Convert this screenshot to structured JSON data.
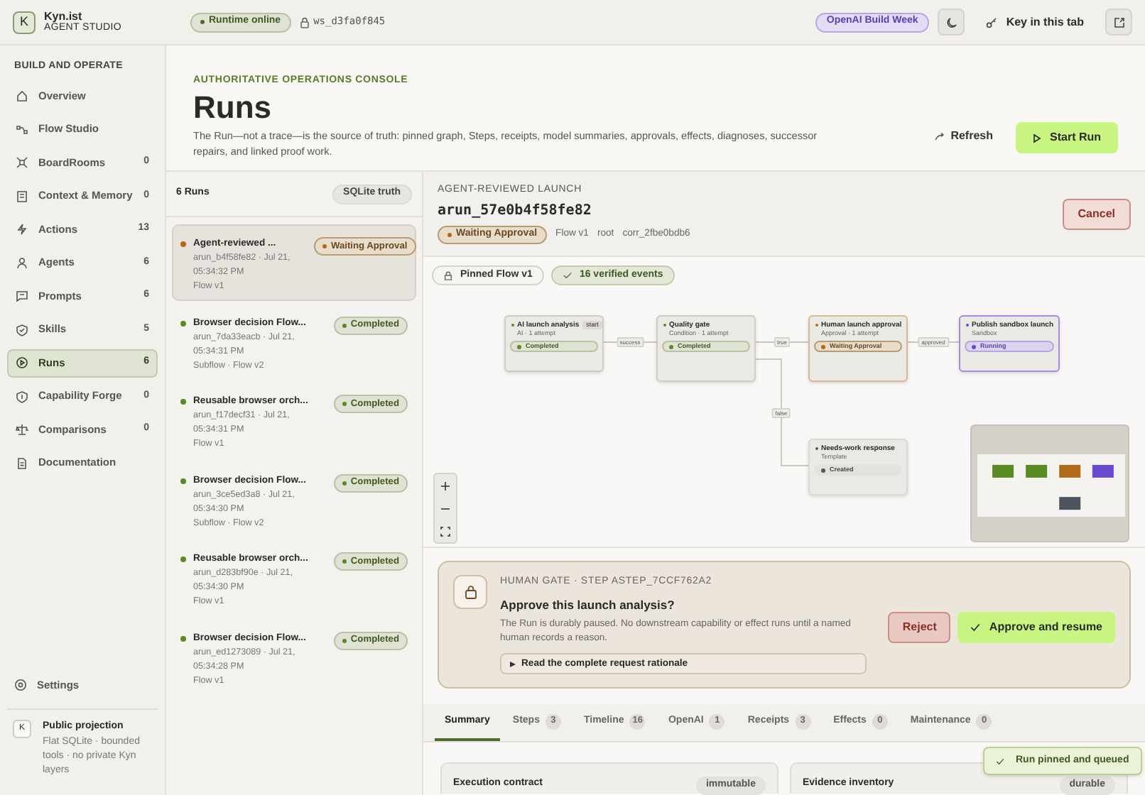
{
  "top_bar": {
    "brand": {
      "logo": "K",
      "name": "Kyn.ist",
      "subtitle": "AGENT STUDIO"
    },
    "runtime_status": "Runtime online",
    "workspace": "ws_d3fa0f845",
    "event_badge": "OpenAI Build Week",
    "key_button": "Key in this tab"
  },
  "sidebar": {
    "section": "BUILD AND OPERATE",
    "items": [
      {
        "label": "Overview",
        "selected": false
      },
      {
        "label": "Flow Studio",
        "selected": false
      },
      {
        "label": "BoardRooms",
        "count": "0",
        "selected": false
      },
      {
        "label": "Context & Memory",
        "count": "0",
        "selected": false
      },
      {
        "label": "Actions",
        "count": "13",
        "selected": false
      },
      {
        "label": "Agents",
        "count": "6",
        "selected": false
      },
      {
        "label": "Prompts",
        "count": "6",
        "selected": false
      },
      {
        "label": "Skills",
        "count": "5",
        "selected": false
      },
      {
        "label": "Runs",
        "count": "6",
        "selected": true
      },
      {
        "label": "Capability Forge",
        "count": "0",
        "selected": false
      },
      {
        "label": "Comparisons",
        "count": "0",
        "selected": false
      },
      {
        "label": "Documentation",
        "selected": false
      }
    ],
    "settings": "Settings",
    "projection": {
      "logo": "K",
      "title": "Public projection",
      "text": "Flat SQLite · bounded tools · no private Kyn layers"
    }
  },
  "header": {
    "eyebrow": "AUTHORITATIVE OPERATIONS CONSOLE",
    "title": "Runs",
    "description": "The Run—not a trace—is the source of truth: pinned graph, Steps, receipts, model summaries, approvals, effects, diagnoses, successor repairs, and linked proof work.",
    "refresh": "Refresh",
    "start": "Start Run"
  },
  "runs_list": {
    "count": "6 Runs",
    "badge": "SQLite truth",
    "runs": [
      {
        "title": "Agent-reviewed ...",
        "details": "arun_b4f58fe82 · Jul 21, 05:34:32 PM",
        "meta": "Flow v1",
        "status": "Waiting Approval",
        "kind": "waiting",
        "selected": true
      },
      {
        "title": "Browser decision Flow...",
        "details": "arun_7da33eacb · Jul 21, 05:34:31 PM",
        "meta": "Subflow · Flow v2",
        "status": "Completed",
        "kind": "completed",
        "selected": false
      },
      {
        "title": "Reusable browser orch...",
        "details": "arun_f17decf31 · Jul 21, 05:34:31 PM",
        "meta": "Flow v1",
        "status": "Completed",
        "kind": "completed",
        "selected": false
      },
      {
        "title": "Browser decision Flow...",
        "details": "arun_3ce5ed3a8 · Jul 21, 05:34:30 PM",
        "meta": "Subflow · Flow v2",
        "status": "Completed",
        "kind": "completed",
        "selected": false
      },
      {
        "title": "Reusable browser orch...",
        "details": "arun_d283bf90e · Jul 21, 05:34:30 PM",
        "meta": "Flow v1",
        "status": "Completed",
        "kind": "completed",
        "selected": false
      },
      {
        "title": "Browser decision Flow...",
        "details": "arun_ed1273089 · Jul 21, 05:34:28 PM",
        "meta": "Flow v1",
        "status": "Completed",
        "kind": "completed",
        "selected": false
      }
    ]
  },
  "detail": {
    "eyebrow": "AGENT-REVIEWED LAUNCH",
    "run_id": "arun_57e0b4f58fe82",
    "status": "Waiting Approval",
    "kind": "waiting",
    "meta": [
      "Flow v1",
      "root",
      "corr_2fbe0bdb6"
    ],
    "cancel": "Cancel",
    "pins": [
      "Pinned Flow v1",
      "16 verified events"
    ],
    "graph": {
      "nodes": [
        {
          "title": "AI launch analysis",
          "subtitle": "AI · 1 attempt",
          "tag": "start",
          "status": "Completed",
          "kind": "completed"
        },
        {
          "title": "Quality gate",
          "subtitle": "Condition · 1 attempt",
          "status": "Completed",
          "kind": "completed"
        },
        {
          "title": "Human launch approval",
          "subtitle": "Approval · 1 attempt",
          "status": "Waiting Approval",
          "kind": "waiting"
        },
        {
          "title": "Publish sandbox launch",
          "subtitle": "Sandbox",
          "status": "Running",
          "kind": "running"
        },
        {
          "title": "Needs-work response",
          "subtitle": "Template",
          "status": "Created",
          "kind": "created"
        }
      ],
      "edges": [
        {
          "label": "success"
        },
        {
          "label": "true"
        },
        {
          "label": "approved"
        },
        {
          "label": "false"
        }
      ]
    },
    "gate": {
      "eyebrow": "HUMAN GATE · STEP ASTEP_7CCF762A2",
      "title": "Approve this launch analysis?",
      "text": "The Run is durably paused. No downstream capability or effect runs until a named human records a reason.",
      "rationale": "Read the complete request rationale",
      "reject": "Reject",
      "approve": "Approve and resume"
    },
    "tabs": [
      {
        "label": "Summary",
        "selected": true
      },
      {
        "label": "Steps",
        "count": "3",
        "selected": false
      },
      {
        "label": "Timeline",
        "count": "16",
        "selected": false
      },
      {
        "label": "OpenAI",
        "count": "1",
        "selected": false
      },
      {
        "label": "Receipts",
        "count": "3",
        "selected": false
      },
      {
        "label": "Effects",
        "count": "0",
        "selected": false
      },
      {
        "label": "Maintenance",
        "count": "0",
        "selected": false
      }
    ],
    "cards": [
      {
        "title": "Execution contract",
        "badge": "immutable"
      },
      {
        "title": "Evidence inventory",
        "badge": "durable"
      }
    ]
  },
  "toast": "Run pinned and queued"
}
